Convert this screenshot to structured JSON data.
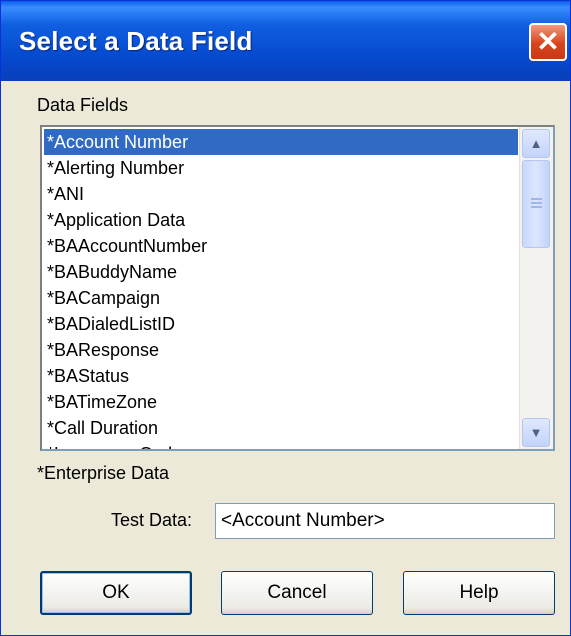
{
  "dialog": {
    "title": "Select a Data Field",
    "close_symbol": "✕",
    "close_icon": "close-icon"
  },
  "data_fields": {
    "label": "Data Fields",
    "items": [
      "*Account Number",
      "*Alerting Number",
      "*ANI",
      "*Application Data",
      "*BAAccountNumber",
      "*BABuddyName",
      "*BACampaign",
      "*BADialedListID",
      "*BAResponse",
      "*BAStatus",
      "*BATimeZone",
      "*Call Duration",
      "*Language Code"
    ],
    "selected_index": 0,
    "scrollbar": {
      "up_icon": "scroll-up-icon",
      "down_icon": "scroll-down-icon"
    }
  },
  "footnote": "*Enterprise Data",
  "test_data": {
    "label": "Test Data:",
    "value": "<Account Number>"
  },
  "buttons": {
    "ok": "OK",
    "cancel": "Cancel",
    "help": "Help"
  },
  "colors": {
    "titlebar": "#0549cf",
    "selection": "#316ac5",
    "dialog_bg": "#ece9d8",
    "close_button": "#d8441c"
  }
}
